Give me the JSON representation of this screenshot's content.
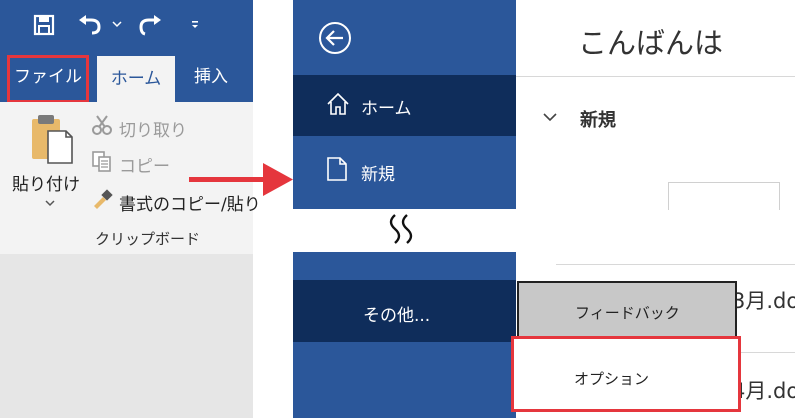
{
  "ribbon": {
    "tabs": {
      "file": "ファイル",
      "home": "ホーム",
      "insert": "挿入"
    },
    "clipboard": {
      "paste": "貼り付け",
      "cut": "切り取り",
      "copy": "コピー",
      "format_painter": "書式のコピー/貼り",
      "group_label": "クリップボード"
    }
  },
  "backstage": {
    "nav": {
      "home": "ホーム",
      "new": "新規",
      "more": "その他..."
    },
    "greeting": "こんばんは",
    "new_section": "新規",
    "files": [
      "3月.do",
      "4月.do"
    ]
  },
  "more_menu": {
    "feedback": "フィードバック",
    "options": "オプション"
  },
  "colors": {
    "word_blue": "#2b579a",
    "nav_dark": "#0f2d5b",
    "highlight_red": "#e5363d",
    "arrow_red": "#e5363d"
  }
}
